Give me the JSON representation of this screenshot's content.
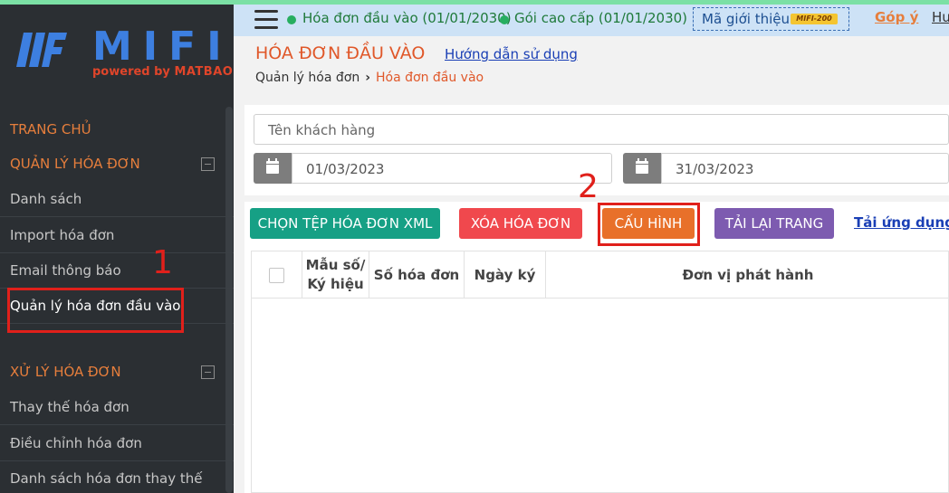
{
  "app": {
    "logo_text": "MIFI",
    "tagline_prefix": "powered by ",
    "tagline_brand": "MATBAO"
  },
  "header": {
    "status_1": "Hóa đơn đầu vào (01/01/2030)",
    "status_2": "Gói cao cấp (01/01/2030)",
    "referral_label": "Mã giới thiệu",
    "referral_badge": "MIFI-200",
    "feedback_link": "Góp ý",
    "help_link_partial": "Hư",
    "status_color": "#27ae60"
  },
  "sidebar": {
    "sections": [
      {
        "label": "TRANG CHỦ"
      },
      {
        "label": "QUẢN LÝ HÓA ĐƠN",
        "items": [
          {
            "label": "Danh sách"
          },
          {
            "label": "Import hóa đơn"
          },
          {
            "label": "Email thông báo"
          },
          {
            "label": "Quản lý hóa đơn đầu vào",
            "active": true
          }
        ]
      },
      {
        "label": "XỬ LÝ HÓA ĐƠN",
        "items": [
          {
            "label": "Thay thế hóa đơn"
          },
          {
            "label": "Điều chỉnh hóa đơn"
          },
          {
            "label": "Danh sách hóa đơn thay thế"
          }
        ]
      }
    ]
  },
  "page": {
    "title": "HÓA ĐƠN ĐẦU VÀO",
    "guide_link": "Hướng dẫn sử dụng",
    "breadcrumb": {
      "root": "Quản lý hóa đơn",
      "separator": "›",
      "current": "Hóa đơn đầu vào"
    }
  },
  "filters": {
    "customer_placeholder": "Tên khách hàng",
    "date_from": "01/03/2023",
    "date_to": "31/03/2023"
  },
  "toolbar": {
    "select_xml": "CHỌN TỆP HÓA ĐƠN XML",
    "delete": "XÓA HÓA ĐƠN",
    "config": "CẤU HÌNH",
    "reload": "TẢI LẠI TRANG",
    "app_download": "Tải ứng dụng h"
  },
  "table": {
    "columns": [
      "Mẫu số/ Ký hiệu",
      "Số hóa đơn",
      "Ngày ký",
      "Đơn vị phát hành"
    ],
    "rows": []
  },
  "annotations": {
    "step_1": "1",
    "step_2": "2",
    "highlight_color": "#e0201b"
  }
}
